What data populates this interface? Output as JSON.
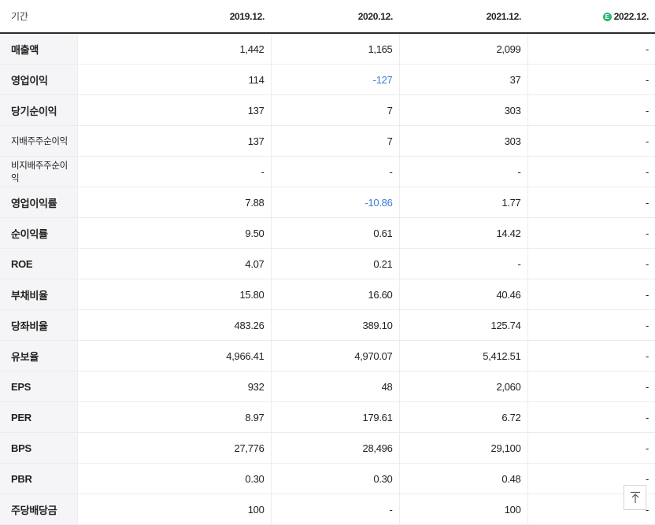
{
  "header": {
    "label": "기간",
    "periods": [
      "2019.12.",
      "2020.12.",
      "2021.12.",
      "2022.12."
    ],
    "estimate_badge": "E",
    "estimate_color": "#2bb673"
  },
  "negative_color": "#3a7bd5",
  "rows": [
    {
      "label": "매출액",
      "values": [
        "1,442",
        "1,165",
        "2,099",
        "-"
      ]
    },
    {
      "label": "영업이익",
      "values": [
        "114",
        "-127",
        "37",
        "-"
      ]
    },
    {
      "label": "당기순이익",
      "values": [
        "137",
        "7",
        "303",
        "-"
      ]
    },
    {
      "label": "지배주주순이익",
      "values": [
        "137",
        "7",
        "303",
        "-"
      ]
    },
    {
      "label": "비지배주주순이익",
      "values": [
        "-",
        "-",
        "-",
        "-"
      ]
    },
    {
      "label": "영업이익률",
      "values": [
        "7.88",
        "-10.86",
        "1.77",
        "-"
      ]
    },
    {
      "label": "순이익률",
      "values": [
        "9.50",
        "0.61",
        "14.42",
        "-"
      ]
    },
    {
      "label": "ROE",
      "values": [
        "4.07",
        "0.21",
        "-",
        "-"
      ]
    },
    {
      "label": "부채비율",
      "values": [
        "15.80",
        "16.60",
        "40.46",
        "-"
      ]
    },
    {
      "label": "당좌비율",
      "values": [
        "483.26",
        "389.10",
        "125.74",
        "-"
      ]
    },
    {
      "label": "유보율",
      "values": [
        "4,966.41",
        "4,970.07",
        "5,412.51",
        "-"
      ]
    },
    {
      "label": "EPS",
      "values": [
        "932",
        "48",
        "2,060",
        "-"
      ]
    },
    {
      "label": "PER",
      "values": [
        "8.97",
        "179.61",
        "6.72",
        "-"
      ]
    },
    {
      "label": "BPS",
      "values": [
        "27,776",
        "28,496",
        "29,100",
        "-"
      ]
    },
    {
      "label": "PBR",
      "values": [
        "0.30",
        "0.30",
        "0.48",
        "-"
      ]
    },
    {
      "label": "주당배당금",
      "values": [
        "100",
        "-",
        "100",
        "-"
      ]
    }
  ],
  "scroll_top_button": {
    "icon": "arrow-up-to-top-icon"
  }
}
